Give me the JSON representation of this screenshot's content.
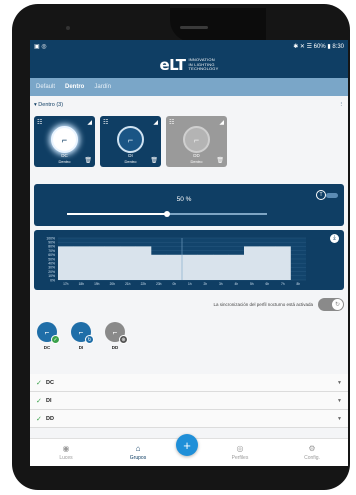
{
  "statusbar": {
    "left_icons": "▣ ◎",
    "right_text": "✱ ✕ ☰ 60% ▮ 8:30"
  },
  "header": {
    "logo_mark": "eLT",
    "logo_line1": "INNOVATION",
    "logo_line2": "IN LIGHTING",
    "logo_line3": "TECHNOLOGY"
  },
  "tabs": [
    {
      "label": "Default",
      "active": false
    },
    {
      "label": "Dentro",
      "active": true
    },
    {
      "label": "Jardín",
      "active": false
    }
  ],
  "group": {
    "label": "Dentro (3)",
    "menu_icon": "⋮"
  },
  "cards": [
    {
      "name": "DC",
      "sub": "Dentro",
      "style": "glow"
    },
    {
      "name": "DI",
      "sub": "Dentro",
      "style": "dim"
    },
    {
      "name": "DD",
      "sub": "Dentro",
      "style": "gray"
    }
  ],
  "dimmer": {
    "value_text": "50 %",
    "value": 50,
    "toggle_glyph": "T"
  },
  "chart_data": {
    "type": "area",
    "title": "",
    "y_ticks": [
      "100%",
      "90%",
      "80%",
      "70%",
      "60%",
      "50%",
      "40%",
      "30%",
      "20%",
      "10%",
      "0%"
    ],
    "x_ticks": [
      "17h",
      "18h",
      "19h",
      "20h",
      "21h",
      "22h",
      "23h",
      "0h",
      "1h",
      "2h",
      "3h",
      "4h",
      "5h",
      "6h",
      "7h",
      "8h"
    ],
    "values": [
      80,
      80,
      80,
      80,
      80,
      80,
      60,
      60,
      60,
      60,
      60,
      60,
      80,
      80,
      80,
      0
    ],
    "ylim": [
      0,
      100
    ],
    "grid": true,
    "current_marker": "1h"
  },
  "sync": {
    "text": "La sincronización del perfil nocturno está activada",
    "on": true
  },
  "devices": [
    {
      "label": "DC",
      "badge": "✓",
      "badge_color": "#3aa14a",
      "style": "blue"
    },
    {
      "label": "DI",
      "badge": "↻",
      "badge_color": "#1f6ea8",
      "style": "blue"
    },
    {
      "label": "DD",
      "badge": "⊕",
      "badge_color": "#555555",
      "style": "gray"
    }
  ],
  "list": [
    {
      "label": "DC"
    },
    {
      "label": "DI"
    },
    {
      "label": "DD"
    }
  ],
  "bottom_nav": [
    {
      "label": "Luces",
      "icon": "◉",
      "active": false
    },
    {
      "label": "Grupos",
      "icon": "⌂",
      "active": true
    },
    {
      "label": "Perfiles",
      "icon": "◎",
      "active": false
    },
    {
      "label": "Config.",
      "icon": "⚙",
      "active": false
    }
  ],
  "fab": {
    "label": "+"
  },
  "colors": {
    "primary": "#0f3e64",
    "tab_bar": "#7aa6c8",
    "accent": "#1f8fd8",
    "success": "#3aa14a"
  }
}
